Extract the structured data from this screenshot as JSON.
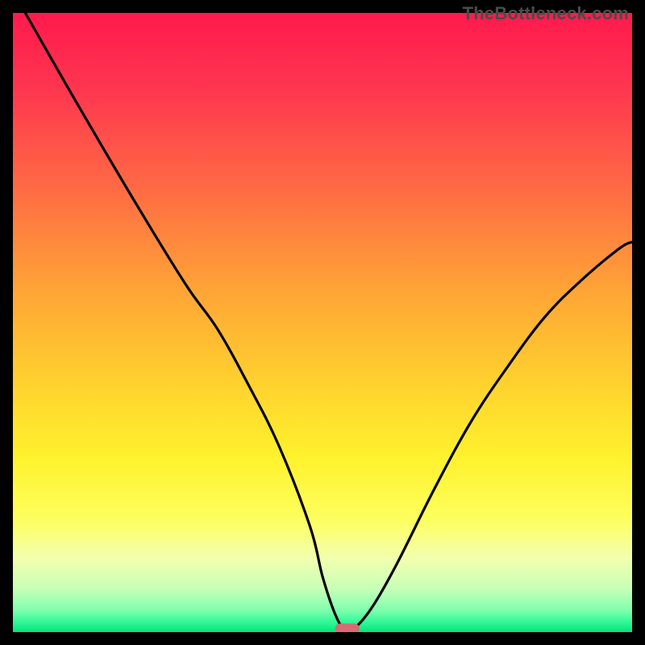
{
  "watermark": "TheBottleneck.com",
  "chart_data": {
    "type": "line",
    "title": "",
    "xlabel": "",
    "ylabel": "",
    "xlim": [
      0,
      100
    ],
    "ylim": [
      0,
      100
    ],
    "grid": false,
    "series": [
      {
        "name": "curve",
        "x": [
          2,
          10,
          20,
          28,
          33,
          38,
          43,
          48,
          50,
          52,
          53.5,
          55,
          58,
          62,
          68,
          74,
          80,
          86,
          92,
          98,
          100
        ],
        "y": [
          100,
          86,
          69,
          56,
          49,
          40,
          30,
          17,
          9,
          3,
          0.5,
          0.5,
          4,
          11,
          23,
          34,
          43,
          51,
          57,
          62,
          63
        ]
      }
    ],
    "marker": {
      "x": 54,
      "y": 0.6,
      "color": "#d86b74"
    },
    "background_gradient": {
      "stops": [
        {
          "offset": 0.0,
          "color": "#ff1a4d"
        },
        {
          "offset": 0.12,
          "color": "#ff3550"
        },
        {
          "offset": 0.3,
          "color": "#ff7043"
        },
        {
          "offset": 0.45,
          "color": "#ffa536"
        },
        {
          "offset": 0.6,
          "color": "#ffd22e"
        },
        {
          "offset": 0.72,
          "color": "#fff22e"
        },
        {
          "offset": 0.82,
          "color": "#fdff60"
        },
        {
          "offset": 0.88,
          "color": "#f3ffae"
        },
        {
          "offset": 0.93,
          "color": "#c7ffb8"
        },
        {
          "offset": 0.965,
          "color": "#7fffad"
        },
        {
          "offset": 0.985,
          "color": "#2cf796"
        },
        {
          "offset": 1.0,
          "color": "#03e37a"
        }
      ]
    }
  }
}
